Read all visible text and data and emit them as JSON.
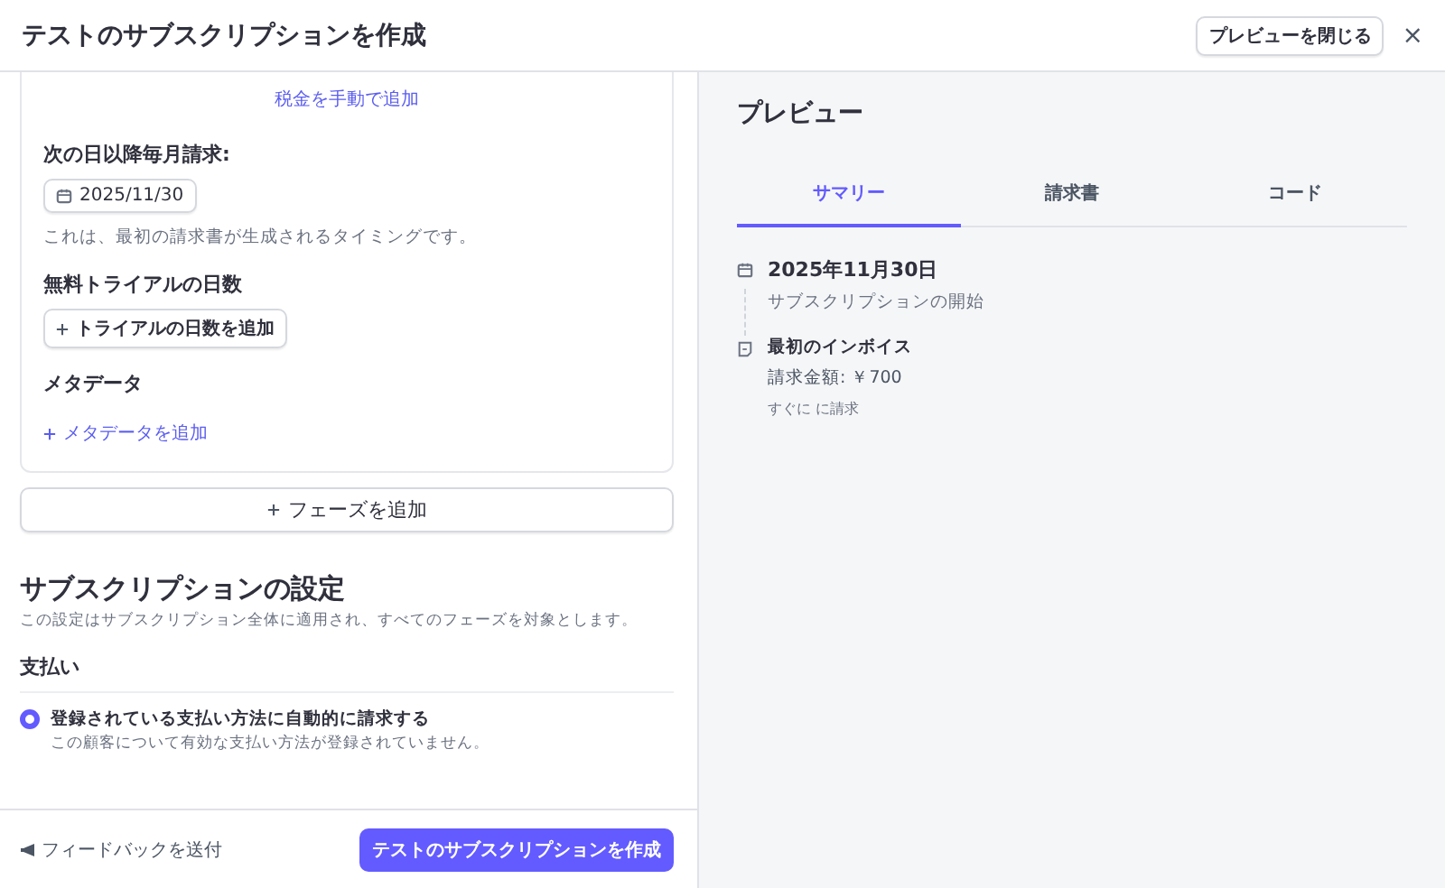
{
  "window": {
    "title": "テストのサブスクリプションを作成",
    "close_preview_button": "プレビューを閉じる",
    "close_button": "×"
  },
  "phase": {
    "tax_link": "税金を手動で追加",
    "billing_label": "次の日以降毎月請求:",
    "billing_date": "2025/11/30",
    "billing_hint": "これは、最初の請求書が生成されるタイミングです。",
    "trial_label": "無料トライアルの日数",
    "trial_button": "トライアルの日数を追加",
    "metadata_label": "メタデータ",
    "metadata_link": "メタデータを追加"
  },
  "add_phase_button": "フェーズを追加",
  "settings": {
    "title": "サブスクリプションの設定",
    "description": "この設定はサブスクリプション全体に適用され、すべてのフェーズを対象とします。",
    "payment_label": "支払い",
    "options": [
      {
        "label": "登録されている支払い方法に自動的に請求する",
        "hint": "この顧客について有効な支払い方法が登録されていません。",
        "selected": true
      }
    ]
  },
  "footer": {
    "feedback_link": "フィードバックを送付",
    "create_button": "テストのサブスクリプションを作成"
  },
  "preview": {
    "title": "プレビュー",
    "tabs": [
      {
        "label": "サマリー",
        "selected": true
      },
      {
        "label": "請求書",
        "selected": false
      },
      {
        "label": "コード",
        "selected": false
      }
    ],
    "timeline": [
      {
        "kind": "date",
        "title": "2025年11月30日",
        "lines": [
          "サブスクリプションの開始"
        ]
      },
      {
        "kind": "invoice",
        "title": "最初のインボイス",
        "lines": [
          "請求金額: ￥700",
          "すぐに に請求"
        ]
      }
    ]
  }
}
